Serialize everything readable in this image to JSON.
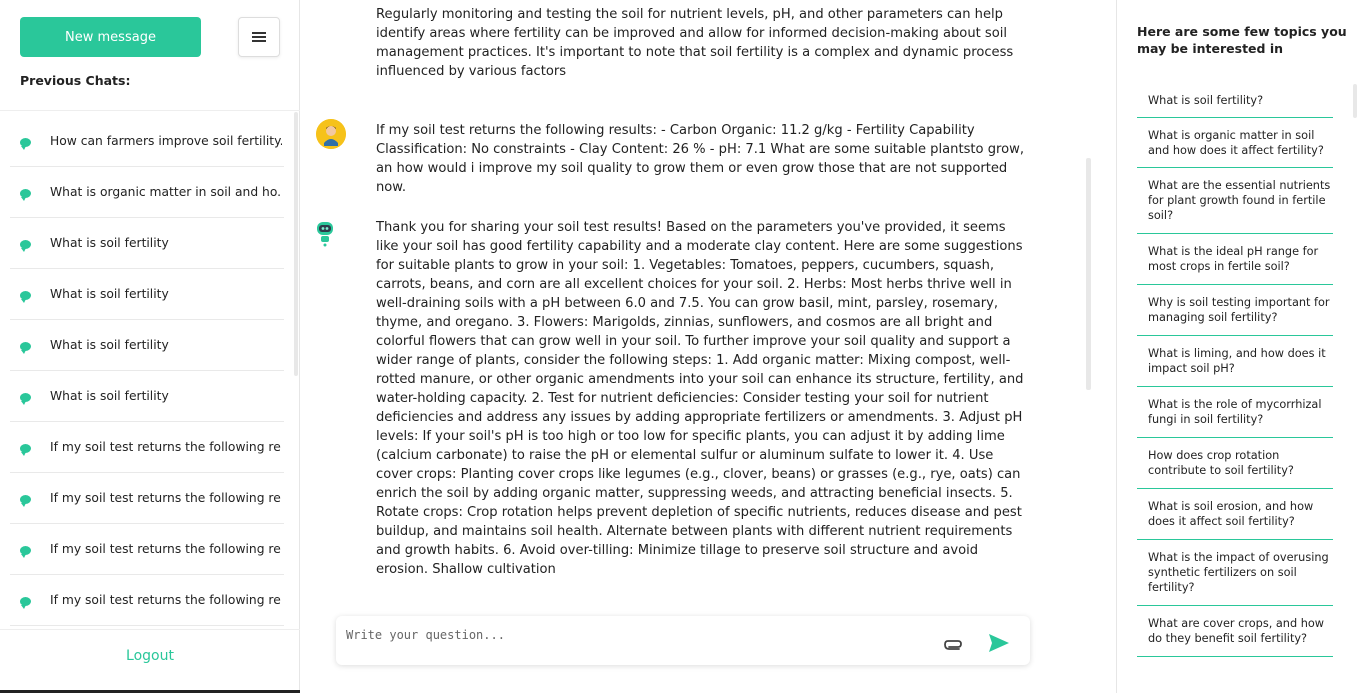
{
  "sidebar": {
    "new_message": "New message",
    "previous_chats_title": "Previous Chats:",
    "chats": [
      "How can farmers improve soil fertility...",
      "What is organic matter in soil and ho...",
      "What is soil fertility",
      "What is soil fertility",
      "What is soil fertility",
      "What is soil fertility",
      "If my soil test returns the following re...",
      "If my soil test returns the following re...",
      "If my soil test returns the following re...",
      "If my soil test returns the following re..."
    ],
    "logout": "Logout"
  },
  "messages": [
    {
      "role": "assistant",
      "text": "Regularly monitoring and testing the soil for nutrient levels, pH, and other parameters can help identify areas where fertility can be improved and allow for informed decision-making about soil management practices. It's important to note that soil fertility is a complex and dynamic process influenced by various factors"
    },
    {
      "role": "user",
      "text": "If my soil test returns the following results: - Carbon Organic: 11.2 g/kg - Fertility Capability Classification: No constraints - Clay Content: 26 % - pH: 7.1 What are some suitable plantsto grow, an how would i improve my soil quality to grow them or even grow those that are not supported now."
    },
    {
      "role": "assistant",
      "text": "Thank you for sharing your soil test results! Based on the parameters you've provided, it seems like your soil has good fertility capability and a moderate clay content. Here are some suggestions for suitable plants to grow in your soil: 1. Vegetables: Tomatoes, peppers, cucumbers, squash, carrots, beans, and corn are all excellent choices for your soil. 2. Herbs: Most herbs thrive well in well-draining soils with a pH between 6.0 and 7.5. You can grow basil, mint, parsley, rosemary, thyme, and oregano. 3. Flowers: Marigolds, zinnias, sunflowers, and cosmos are all bright and colorful flowers that can grow well in your soil. To further improve your soil quality and support a wider range of plants, consider the following steps: 1. Add organic matter: Mixing compost, well-rotted manure, or other organic amendments into your soil can enhance its structure, fertility, and water-holding capacity. 2. Test for nutrient deficiencies: Consider testing your soil for nutrient deficiencies and address any issues by adding appropriate fertilizers or amendments. 3. Adjust pH levels: If your soil's pH is too high or too low for specific plants, you can adjust it by adding lime (calcium carbonate) to raise the pH or elemental sulfur or aluminum sulfate to lower it. 4. Use cover crops: Planting cover crops like legumes (e.g., clover, beans) or grasses (e.g., rye, oats) can enrich the soil by adding organic matter, suppressing weeds, and attracting beneficial insects. 5. Rotate crops: Crop rotation helps prevent depletion of specific nutrients, reduces disease and pest buildup, and maintains soil health. Alternate between plants with different nutrient requirements and growth habits. 6. Avoid over-tilling: Minimize tillage to preserve soil structure and avoid erosion. Shallow cultivation"
    }
  ],
  "composer": {
    "placeholder": "Write your question..."
  },
  "topics": {
    "title": "Here are some few topics you may be interested in",
    "items": [
      "What is soil fertility?",
      "What is organic matter in soil and how does it affect fertility?",
      "What are the essential nutrients for plant growth found in fertile soil?",
      "What is the ideal pH range for most crops in fertile soil?",
      "Why is soil testing important for managing soil fertility?",
      "What is liming, and how does it impact soil pH?",
      "What is the role of mycorrhizal fungi in soil fertility?",
      "How does crop rotation contribute to soil fertility?",
      "What is soil erosion, and how does it affect soil fertility?",
      "What is the impact of overusing synthetic fertilizers on soil fertility?",
      "What are cover crops, and how do they benefit soil fertility?"
    ]
  },
  "colors": {
    "accent": "#2ac79a",
    "user_avatar": "#f6c21a"
  },
  "icons": [
    "hamburger-menu-icon",
    "chat-bubble-icon",
    "user-avatar-icon",
    "bot-avatar-icon",
    "paperclip-icon",
    "send-icon"
  ]
}
